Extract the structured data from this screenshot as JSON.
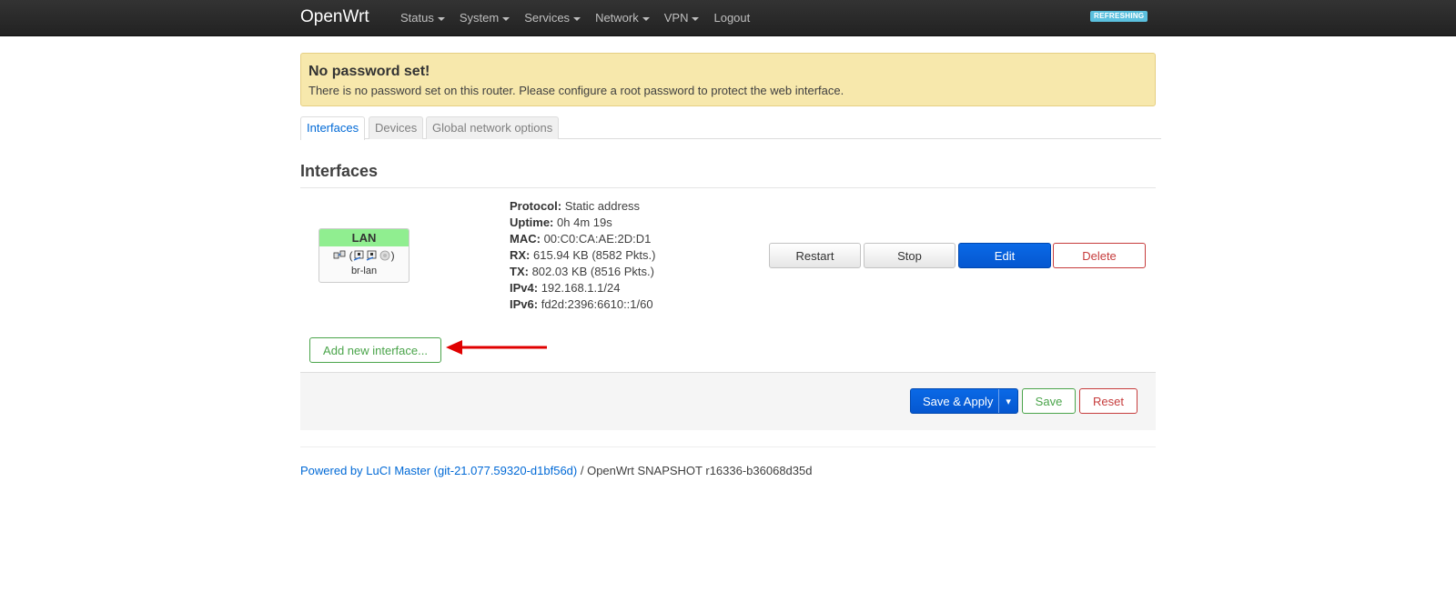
{
  "navbar": {
    "brand": "OpenWrt",
    "menu": [
      "Status",
      "System",
      "Services",
      "Network",
      "VPN",
      "Logout"
    ],
    "refresh_badge": "REFRESHING"
  },
  "alert": {
    "title": "No password set!",
    "text": "There is no password set on this router. Please configure a root password to protect the web interface."
  },
  "tabs": [
    "Interfaces",
    "Devices",
    "Global network options"
  ],
  "section": {
    "title": "Interfaces"
  },
  "interface": {
    "name": "LAN",
    "device": "br-lan",
    "icons_text": "(",
    "icons_close": ")",
    "head_color": "#90ee90",
    "status": [
      {
        "label": "Protocol:",
        "value": "Static address"
      },
      {
        "label": "Uptime:",
        "value": "0h 4m 19s"
      },
      {
        "label": "MAC:",
        "value": "00:C0:CA:AE:2D:D1"
      },
      {
        "label": "RX:",
        "value": "615.94 KB (8582 Pkts.)"
      },
      {
        "label": "TX:",
        "value": "802.03 KB (8516 Pkts.)"
      },
      {
        "label": "IPv4:",
        "value": "192.168.1.1/24"
      },
      {
        "label": "IPv6:",
        "value": "fd2d:2396:6610::1/60"
      }
    ],
    "buttons": {
      "restart": "Restart",
      "stop": "Stop",
      "edit": "Edit",
      "delete": "Delete"
    }
  },
  "add_interface_label": "Add new interface...",
  "actions": {
    "save_apply": "Save & Apply",
    "dropdown": "▾",
    "save": "Save",
    "reset": "Reset"
  },
  "footer": {
    "link": "Powered by LuCI Master (git-21.077.59320-d1bf56d)",
    "text": " / OpenWrt SNAPSHOT r16336-b36068d35d"
  },
  "colors": {
    "primary": "#0557d0",
    "danger": "#c63c3c",
    "success": "#4aa44a",
    "alert_bg": "#f7e8ac",
    "arrow": "#e00000"
  }
}
